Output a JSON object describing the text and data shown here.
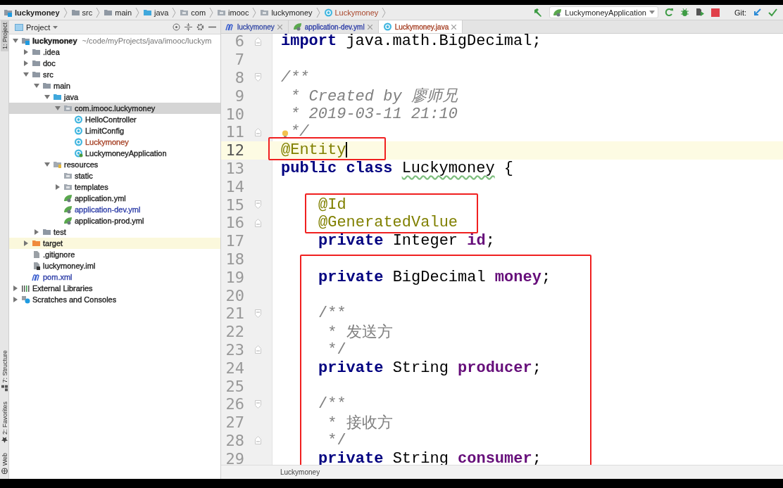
{
  "breadcrumbs": [
    {
      "label": "luckymoney",
      "kind": "module"
    },
    {
      "label": "src",
      "kind": "folder"
    },
    {
      "label": "main",
      "kind": "folder"
    },
    {
      "label": "java",
      "kind": "source"
    },
    {
      "label": "com",
      "kind": "package"
    },
    {
      "label": "imooc",
      "kind": "package"
    },
    {
      "label": "luckymoney",
      "kind": "package"
    },
    {
      "label": "Luckymoney",
      "kind": "class",
      "color": "#a8452a"
    }
  ],
  "toolbar": {
    "run_config": "LuckymoneyApplication",
    "git_label": "Git:"
  },
  "tool_strip": {
    "top": [
      {
        "label": "1: Project",
        "selected": true
      }
    ],
    "bottom": [
      {
        "label": "7: Structure",
        "kind": "structure"
      },
      {
        "label": "2: Favorites",
        "kind": "star"
      },
      {
        "label": "Web",
        "kind": "globe"
      }
    ]
  },
  "project_panel": {
    "title": "Project",
    "tree": [
      {
        "label": "luckymoney",
        "hint": "~/code/myProjects/java/imooc/luckym",
        "kind": "module",
        "expanded": true,
        "selected": false,
        "children": [
          {
            "label": ".idea",
            "kind": "folder",
            "expanded": false,
            "selected": false
          },
          {
            "label": "doc",
            "kind": "folder",
            "expanded": false,
            "selected": false
          },
          {
            "label": "src",
            "kind": "folder",
            "expanded": true,
            "selected": false,
            "children": [
              {
                "label": "main",
                "kind": "folder",
                "expanded": true,
                "selected": false,
                "children": [
                  {
                    "label": "java",
                    "kind": "source",
                    "expanded": true,
                    "selected": false,
                    "children": [
                      {
                        "label": "com.imooc.luckymoney",
                        "kind": "package",
                        "expanded": true,
                        "selected": true,
                        "children": [
                          {
                            "label": "HelloController",
                            "kind": "class",
                            "selected": false
                          },
                          {
                            "label": "LimitConfig",
                            "kind": "class",
                            "selected": false
                          },
                          {
                            "label": "Luckymoney",
                            "kind": "class",
                            "color": "#a8452a",
                            "selected": false
                          },
                          {
                            "label": "LuckymoneyApplication",
                            "kind": "spring-class",
                            "selected": false
                          }
                        ]
                      }
                    ]
                  },
                  {
                    "label": "resources",
                    "kind": "resources",
                    "expanded": true,
                    "selected": false,
                    "children": [
                      {
                        "label": "static",
                        "kind": "package",
                        "selected": false
                      },
                      {
                        "label": "templates",
                        "kind": "package",
                        "expanded": false,
                        "selected": false
                      },
                      {
                        "label": "application.yml",
                        "kind": "spring",
                        "selected": false
                      },
                      {
                        "label": "application-dev.yml",
                        "kind": "spring",
                        "color": "#2f3fa8",
                        "selected": false
                      },
                      {
                        "label": "application-prod.yml",
                        "kind": "spring",
                        "selected": false
                      }
                    ]
                  }
                ]
              },
              {
                "label": "test",
                "kind": "folder",
                "expanded": false,
                "selected": false
              }
            ]
          },
          {
            "label": "target",
            "kind": "excluded",
            "expanded": false,
            "excluded": true,
            "selected": false
          },
          {
            "label": ".gitignore",
            "kind": "file",
            "selected": false
          },
          {
            "label": "luckymoney.iml",
            "kind": "iml",
            "selected": false
          },
          {
            "label": "pom.xml",
            "kind": "maven",
            "color": "#2f3fa8",
            "selected": false
          }
        ]
      },
      {
        "label": "External Libraries",
        "kind": "libraries",
        "expanded": false,
        "selected": false
      },
      {
        "label": "Scratches and Consoles",
        "kind": "scratches",
        "expanded": false,
        "selected": false
      }
    ]
  },
  "editor": {
    "tabs": [
      {
        "label": "luckymoney",
        "kind": "maven",
        "color": "#3b4fa8",
        "selected": false
      },
      {
        "label": "application-dev.yml",
        "kind": "spring",
        "color": "#2f3fa8",
        "selected": false
      },
      {
        "label": "Luckymoney.java",
        "kind": "class",
        "color": "#a8452a",
        "selected": true
      }
    ],
    "lines": [
      {
        "number": "6",
        "fold_end": true,
        "tokens": [
          {
            "kind": "keyword",
            "text": "import"
          },
          {
            "kind": "plain",
            "text": " java.math.BigDecimal;"
          }
        ]
      },
      {
        "number": "7"
      },
      {
        "number": "8",
        "fold_start": true,
        "tokens": [
          {
            "kind": "comment",
            "text": "/**"
          }
        ]
      },
      {
        "number": "9",
        "tokens": [
          {
            "kind": "comment",
            "text": " * Created by 廖师兄"
          }
        ]
      },
      {
        "number": "10",
        "tokens": [
          {
            "kind": "comment",
            "text": " * 2019-03-11 21:10"
          }
        ]
      },
      {
        "number": "11",
        "fold_end": true,
        "bulb": true,
        "tokens": [
          {
            "kind": "comment",
            "text": "*/"
          }
        ]
      },
      {
        "number": "12",
        "current": true,
        "tokens": [
          {
            "kind": "annotation",
            "text": "@Entity"
          }
        ]
      },
      {
        "number": "13",
        "tokens": [
          {
            "kind": "keyword",
            "text": "public class "
          },
          {
            "kind": "typo",
            "text": "Luckymoney"
          },
          {
            "kind": "plain",
            "text": " {"
          }
        ]
      },
      {
        "number": "14"
      },
      {
        "number": "15",
        "fold_start": true,
        "indented": true,
        "tokens": [
          {
            "kind": "annotation",
            "text": "@Id"
          }
        ]
      },
      {
        "number": "16",
        "fold_end": true,
        "indented": true,
        "tokens": [
          {
            "kind": "annotation",
            "text": "@GeneratedValue"
          }
        ]
      },
      {
        "number": "17",
        "indented": true,
        "tokens": [
          {
            "kind": "keyword",
            "text": "private "
          },
          {
            "kind": "plain",
            "text": "Integer "
          },
          {
            "kind": "field",
            "text": "id"
          },
          {
            "kind": "plain",
            "text": ";"
          }
        ]
      },
      {
        "number": "18"
      },
      {
        "number": "19",
        "indented": true,
        "tokens": [
          {
            "kind": "keyword",
            "text": "private "
          },
          {
            "kind": "plain",
            "text": "BigDecimal "
          },
          {
            "kind": "field",
            "text": "money"
          },
          {
            "kind": "plain",
            "text": ";"
          }
        ]
      },
      {
        "number": "20"
      },
      {
        "number": "21",
        "fold_start": true,
        "indented": true,
        "tokens": [
          {
            "kind": "doc",
            "text": "/**"
          }
        ]
      },
      {
        "number": "22",
        "indented": true,
        "tokens": [
          {
            "kind": "doc",
            "text": " * 发送方"
          }
        ]
      },
      {
        "number": "23",
        "fold_end": true,
        "indented": true,
        "tokens": [
          {
            "kind": "doc",
            "text": " */"
          }
        ]
      },
      {
        "number": "24",
        "indented": true,
        "tokens": [
          {
            "kind": "keyword",
            "text": "private "
          },
          {
            "kind": "plain",
            "text": "String "
          },
          {
            "kind": "field",
            "text": "producer"
          },
          {
            "kind": "plain",
            "text": ";"
          }
        ]
      },
      {
        "number": "25"
      },
      {
        "number": "26",
        "fold_start": true,
        "indented": true,
        "tokens": [
          {
            "kind": "doc",
            "text": "/**"
          }
        ]
      },
      {
        "number": "27",
        "indented": true,
        "tokens": [
          {
            "kind": "doc",
            "text": " * 接收方"
          }
        ]
      },
      {
        "number": "28",
        "fold_end": true,
        "indented": true,
        "tokens": [
          {
            "kind": "doc",
            "text": " */"
          }
        ]
      },
      {
        "number": "29",
        "indented": true,
        "tokens": [
          {
            "kind": "keyword",
            "text": "private "
          },
          {
            "kind": "plain",
            "text": "String "
          },
          {
            "kind": "field",
            "text": "consumer"
          },
          {
            "kind": "plain",
            "text": ";"
          }
        ]
      }
    ],
    "frames": [
      {
        "kind": "frame"
      },
      {
        "kind": "frame"
      },
      {
        "kind": "frame"
      }
    ],
    "breadcrumb": "Luckymoney"
  }
}
